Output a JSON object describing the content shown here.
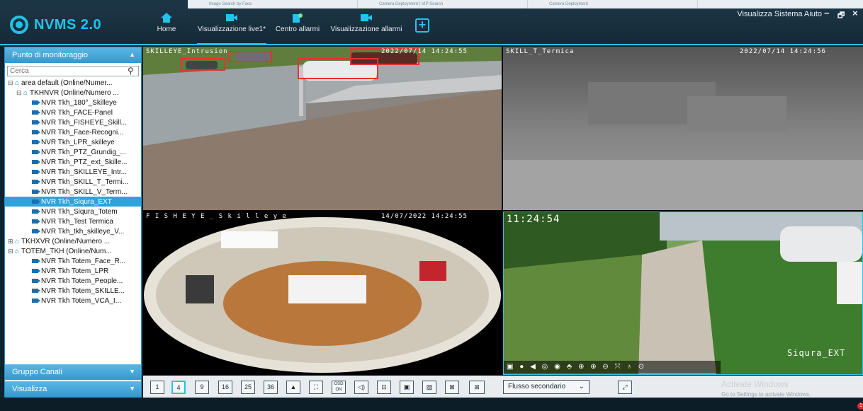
{
  "app": {
    "logo_text": "NVMS 2.0",
    "logo_icon": "nvms-logo-icon",
    "menu_right": "Visualizza Sistema Aiuto",
    "win_minimize": "−",
    "win_restore": "🗗",
    "win_close": "×",
    "add_tab_icon": "+"
  },
  "ghost_tabs": [
    "Image Search by Face",
    "Camera Deployment | VIP Search",
    "Camera Deployment"
  ],
  "nav": [
    {
      "label": "Home",
      "icon": "home-icon"
    },
    {
      "label": "Visualizzazione live1*",
      "icon": "video-camera-icon",
      "active": true
    },
    {
      "label": "Centro allarmi",
      "icon": "alarm-center-icon"
    },
    {
      "label": "Visualizzazione allarmi",
      "icon": "video-camera-icon"
    }
  ],
  "sidebar": {
    "monitor_header": "Punto di monitoraggio",
    "search_placeholder": "Cerca",
    "tree": [
      {
        "label": "area default (Online/Numer...",
        "level": 0,
        "type": "area",
        "expanded": true
      },
      {
        "label": "TKHNVR (Online/Numero ...",
        "level": 1,
        "type": "device",
        "expanded": true
      },
      {
        "label": "NVR Tkh_180°_Skilleye",
        "level": 2,
        "type": "camera"
      },
      {
        "label": "NVR Tkh_FACE-Panel",
        "level": 2,
        "type": "camera"
      },
      {
        "label": "NVR Tkh_FISHEYE_Skill...",
        "level": 2,
        "type": "camera"
      },
      {
        "label": "NVR Tkh_Face-Recogni...",
        "level": 2,
        "type": "camera"
      },
      {
        "label": "NVR Tkh_LPR_skilleye",
        "level": 2,
        "type": "camera"
      },
      {
        "label": "NVR Tkh_PTZ_Grundig_...",
        "level": 2,
        "type": "camera"
      },
      {
        "label": "NVR Tkh_PTZ_ext_Skille...",
        "level": 2,
        "type": "camera"
      },
      {
        "label": "NVR Tkh_SKILLEYE_Intr...",
        "level": 2,
        "type": "camera"
      },
      {
        "label": "NVR Tkh_SKILL_T_Termi...",
        "level": 2,
        "type": "camera"
      },
      {
        "label": "NVR Tkh_SKILL_V_Term...",
        "level": 2,
        "type": "camera"
      },
      {
        "label": "NVR Tkh_Siqura_EXT",
        "level": 2,
        "type": "camera",
        "selected": true
      },
      {
        "label": "NVR Tkh_Siqura_Totem",
        "level": 2,
        "type": "camera"
      },
      {
        "label": "NVR Tkh_Test Termica",
        "level": 2,
        "type": "camera"
      },
      {
        "label": "NVR Tkh_tkh_skilleye_V...",
        "level": 2,
        "type": "camera"
      },
      {
        "label": "TKHXVR (Online/Numero ...",
        "level": 0,
        "type": "device",
        "expanded": false
      },
      {
        "label": "TOTEM_TKH (Online/Num...",
        "level": 0,
        "type": "device",
        "expanded": true
      },
      {
        "label": "NVR Tkh Totem_Face_R...",
        "level": 2,
        "type": "camera"
      },
      {
        "label": "NVR Tkh Totem_LPR",
        "level": 2,
        "type": "camera"
      },
      {
        "label": "NVR Tkh Totem_People...",
        "level": 2,
        "type": "camera"
      },
      {
        "label": "NVR Tkh Totem_SKILLE...",
        "level": 2,
        "type": "camera"
      },
      {
        "label": "NVR Tkh Totem_VCA_I...",
        "level": 2,
        "type": "camera"
      }
    ],
    "group_header": "Gruppo Canali",
    "view_header": "Visualizza"
  },
  "panes": {
    "p1_name": "SKILLEYE_Intrusion",
    "p1_time": "2022/07/14 14:24:55",
    "p2_name": "SKILL_T_Termica",
    "p2_time": "2022/07/14 14:24:56",
    "p3_name": "F I S H E Y E _ S k i l l e y e",
    "p3_time": "14/07/2022 14:24:55",
    "p4_time": "11:24:54",
    "p4_name": "Siqura_EXT",
    "p4_toolbar_icons": "snapshot-icon record-icon audio-icon camera-icon eye-icon zoom-in-icon zoom-out-icon fullscreen-icon mic-icon location-icon"
  },
  "toolbar": {
    "layouts": [
      "1",
      "4",
      "9",
      "16",
      "25",
      "36"
    ],
    "osd_label": "OSD ON",
    "stream_select": "Flusso secondario"
  },
  "activate": {
    "line1": "Activate Windows",
    "line2": "Go to Settings to activate Windows."
  },
  "status": {
    "badge": "1"
  }
}
